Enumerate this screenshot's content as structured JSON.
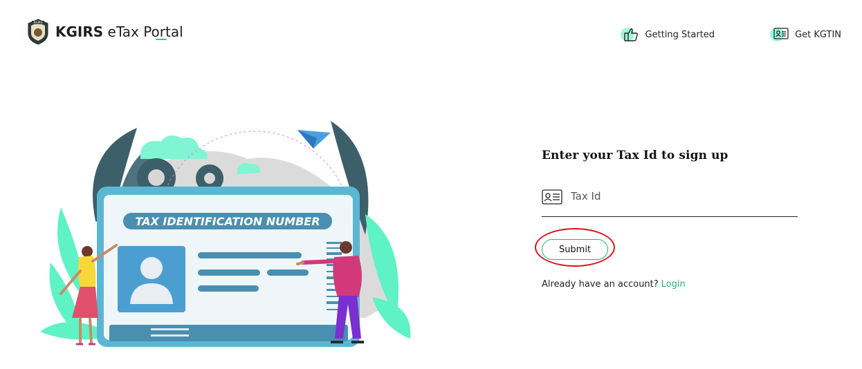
{
  "header": {
    "brand_strong": "KGIRS",
    "brand_light": "eTax Portal",
    "logo_text": "KGIRS",
    "nav": [
      {
        "label": "Getting Started",
        "icon": "thumbs-up-icon"
      },
      {
        "label": "Get KGTIN",
        "icon": "id-card-icon"
      }
    ]
  },
  "illustration": {
    "card_text": "TAX IDENTIFICATION NUMBER"
  },
  "form": {
    "title": "Enter your Tax Id to sign up",
    "input_placeholder": "Tax Id",
    "input_value": "",
    "submit_label": "Submit",
    "login_prompt": "Already have an account?",
    "login_link": "Login"
  },
  "colors": {
    "accent": "#26b07f",
    "mint": "#4ff0c1",
    "highlight": "#e01212",
    "card_blue": "#4a8fb0"
  }
}
